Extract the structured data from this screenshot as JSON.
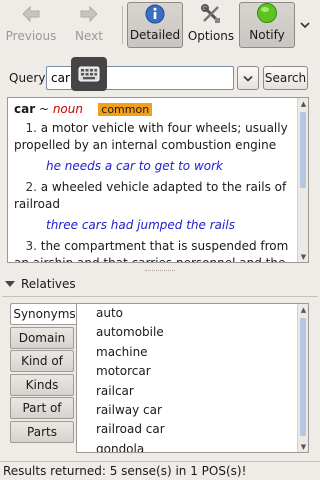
{
  "toolbar": {
    "previous_label": "Previous",
    "next_label": "Next",
    "detailed_label": "Detailed",
    "options_label": "Options",
    "notify_label": "Notify"
  },
  "query": {
    "label": "Query",
    "value": "car",
    "search_label": "Search"
  },
  "definition": {
    "headword": "car",
    "separator": " ~ ",
    "pos": "noun",
    "tag": "common",
    "senses": [
      {
        "num": "1.",
        "gloss": "a motor vehicle with four wheels; usually propelled by an internal combustion engine",
        "example": "he needs a car to get to work"
      },
      {
        "num": "2.",
        "gloss": "a wheeled vehicle adapted to the rails of railroad",
        "example": "three cars had jumped the rails"
      },
      {
        "num": "3.",
        "gloss": "the compartment that is suspended from an airship and that carries personnel and the cargo",
        "example": ""
      }
    ]
  },
  "relatives": {
    "heading": "Relatives",
    "tabs": [
      "Synonyms",
      "Domain",
      "Kind of",
      "Kinds",
      "Part of",
      "Parts"
    ],
    "selected_tab": "Synonyms",
    "items": [
      "auto",
      "automobile",
      "machine",
      "motorcar",
      "railcar",
      "railway car",
      "railroad car",
      "gondola"
    ]
  },
  "status": {
    "text": "Results returned: 5 sense(s) in 1 POS(s)!"
  },
  "colors": {
    "pos": "#cc0000",
    "example": "#2020d0",
    "tag": "#f2a019",
    "notify": "#4caf1a"
  }
}
